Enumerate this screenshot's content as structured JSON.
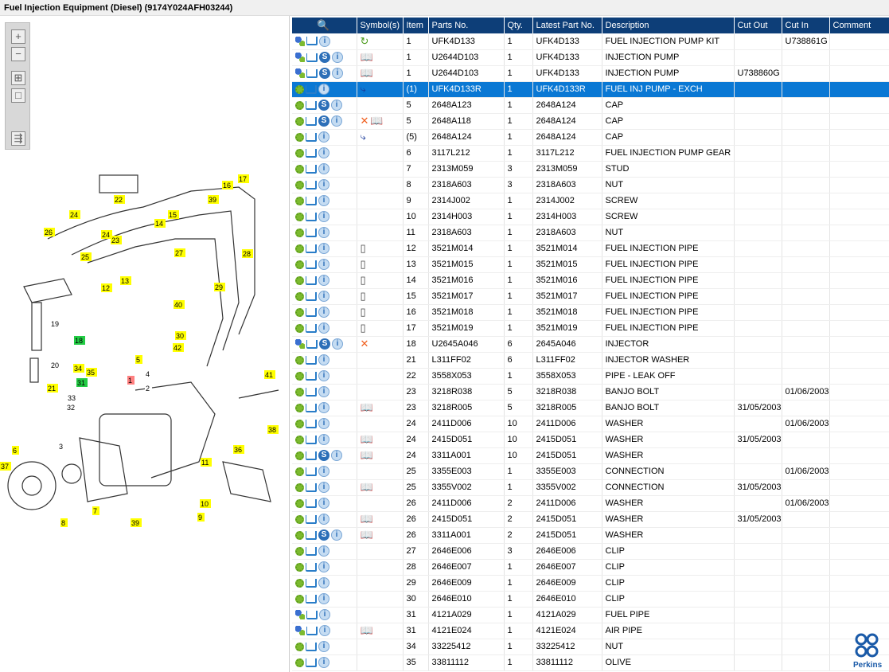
{
  "title": "Fuel Injection Equipment (Diesel) (9174Y024AFH03244)",
  "toolbar": {
    "zoom_in": "+",
    "zoom_out": "−",
    "fit": "⊞",
    "window": "□",
    "export": "⇶"
  },
  "columns": [
    "",
    "Symbol(s)",
    "Item",
    "Parts No.",
    "Qty.",
    "Latest Part No.",
    "Description",
    "Cut Out",
    "Cut In",
    "Comment"
  ],
  "selected_row": 3,
  "rows": [
    {
      "a": "b",
      "s": 0,
      "sym": "rotate",
      "item": "1",
      "part": "UFK4D133",
      "qty": "1",
      "latest": "UFK4D133",
      "desc": "FUEL INJECTION PUMP KIT",
      "out": "",
      "in": "U738861G"
    },
    {
      "a": "b",
      "s": 1,
      "sym": "book",
      "item": "1",
      "part": "U2644D103",
      "qty": "1",
      "latest": "UFK4D133",
      "desc": "INJECTION PUMP",
      "out": "",
      "in": ""
    },
    {
      "a": "b",
      "s": 1,
      "sym": "book",
      "item": "1",
      "part": "U2644D103",
      "qty": "1",
      "latest": "UFK4D133",
      "desc": "INJECTION PUMP",
      "out": "U738860G",
      "in": ""
    },
    {
      "a": "g",
      "s": 0,
      "sym": "arrow",
      "item": "(1)",
      "part": "UFK4D133R",
      "qty": "1",
      "latest": "UFK4D133R",
      "desc": "FUEL INJ PUMP - EXCH",
      "out": "",
      "in": ""
    },
    {
      "a": "g",
      "s": 1,
      "sym": "",
      "item": "5",
      "part": "2648A123",
      "qty": "1",
      "latest": "2648A124",
      "desc": "CAP",
      "out": "",
      "in": ""
    },
    {
      "a": "g",
      "s": 1,
      "sym": "xbook",
      "item": "5",
      "part": "2648A118",
      "qty": "1",
      "latest": "2648A124",
      "desc": "CAP",
      "out": "",
      "in": ""
    },
    {
      "a": "g",
      "s": 0,
      "sym": "arrow",
      "item": "(5)",
      "part": "2648A124",
      "qty": "1",
      "latest": "2648A124",
      "desc": "CAP",
      "out": "",
      "in": ""
    },
    {
      "a": "g",
      "s": 0,
      "sym": "",
      "item": "6",
      "part": "3117L212",
      "qty": "1",
      "latest": "3117L212",
      "desc": "FUEL INJECTION PUMP GEAR",
      "out": "",
      "in": ""
    },
    {
      "a": "g",
      "s": 0,
      "sym": "",
      "item": "7",
      "part": "2313M059",
      "qty": "3",
      "latest": "2313M059",
      "desc": "STUD",
      "out": "",
      "in": ""
    },
    {
      "a": "g",
      "s": 0,
      "sym": "",
      "item": "8",
      "part": "2318A603",
      "qty": "3",
      "latest": "2318A603",
      "desc": "NUT",
      "out": "",
      "in": ""
    },
    {
      "a": "g",
      "s": 0,
      "sym": "",
      "item": "9",
      "part": "2314J002",
      "qty": "1",
      "latest": "2314J002",
      "desc": "SCREW",
      "out": "",
      "in": ""
    },
    {
      "a": "g",
      "s": 0,
      "sym": "",
      "item": "10",
      "part": "2314H003",
      "qty": "1",
      "latest": "2314H003",
      "desc": "SCREW",
      "out": "",
      "in": ""
    },
    {
      "a": "g",
      "s": 0,
      "sym": "",
      "item": "11",
      "part": "2318A603",
      "qty": "1",
      "latest": "2318A603",
      "desc": "NUT",
      "out": "",
      "in": ""
    },
    {
      "a": "g",
      "s": 0,
      "sym": "can",
      "item": "12",
      "part": "3521M014",
      "qty": "1",
      "latest": "3521M014",
      "desc": "FUEL INJECTION PIPE",
      "out": "",
      "in": ""
    },
    {
      "a": "g",
      "s": 0,
      "sym": "can",
      "item": "13",
      "part": "3521M015",
      "qty": "1",
      "latest": "3521M015",
      "desc": "FUEL INJECTION PIPE",
      "out": "",
      "in": ""
    },
    {
      "a": "g",
      "s": 0,
      "sym": "can",
      "item": "14",
      "part": "3521M016",
      "qty": "1",
      "latest": "3521M016",
      "desc": "FUEL INJECTION PIPE",
      "out": "",
      "in": ""
    },
    {
      "a": "g",
      "s": 0,
      "sym": "can",
      "item": "15",
      "part": "3521M017",
      "qty": "1",
      "latest": "3521M017",
      "desc": "FUEL INJECTION PIPE",
      "out": "",
      "in": ""
    },
    {
      "a": "g",
      "s": 0,
      "sym": "can",
      "item": "16",
      "part": "3521M018",
      "qty": "1",
      "latest": "3521M018",
      "desc": "FUEL INJECTION PIPE",
      "out": "",
      "in": ""
    },
    {
      "a": "g",
      "s": 0,
      "sym": "can",
      "item": "17",
      "part": "3521M019",
      "qty": "1",
      "latest": "3521M019",
      "desc": "FUEL INJECTION PIPE",
      "out": "",
      "in": ""
    },
    {
      "a": "b",
      "s": 1,
      "sym": "x",
      "item": "18",
      "part": "U2645A046",
      "qty": "6",
      "latest": "2645A046",
      "desc": "INJECTOR",
      "out": "",
      "in": ""
    },
    {
      "a": "g",
      "s": 0,
      "sym": "",
      "item": "21",
      "part": "L311FF02",
      "qty": "6",
      "latest": "L311FF02",
      "desc": "INJECTOR WASHER",
      "out": "",
      "in": ""
    },
    {
      "a": "g",
      "s": 0,
      "sym": "",
      "item": "22",
      "part": "3558X053",
      "qty": "1",
      "latest": "3558X053",
      "desc": "PIPE - LEAK OFF",
      "out": "",
      "in": ""
    },
    {
      "a": "g",
      "s": 0,
      "sym": "",
      "item": "23",
      "part": "3218R038",
      "qty": "5",
      "latest": "3218R038",
      "desc": "BANJO BOLT",
      "out": "",
      "in": "01/06/2003"
    },
    {
      "a": "g",
      "s": 0,
      "sym": "book",
      "item": "23",
      "part": "3218R005",
      "qty": "5",
      "latest": "3218R005",
      "desc": "BANJO BOLT",
      "out": "31/05/2003",
      "in": ""
    },
    {
      "a": "g",
      "s": 0,
      "sym": "",
      "item": "24",
      "part": "2411D006",
      "qty": "10",
      "latest": "2411D006",
      "desc": "WASHER",
      "out": "",
      "in": "01/06/2003"
    },
    {
      "a": "g",
      "s": 0,
      "sym": "book",
      "item": "24",
      "part": "2415D051",
      "qty": "10",
      "latest": "2415D051",
      "desc": "WASHER",
      "out": "31/05/2003",
      "in": ""
    },
    {
      "a": "g",
      "s": 1,
      "sym": "book",
      "item": "24",
      "part": "3311A001",
      "qty": "10",
      "latest": "2415D051",
      "desc": "WASHER",
      "out": "",
      "in": ""
    },
    {
      "a": "g",
      "s": 0,
      "sym": "",
      "item": "25",
      "part": "3355E003",
      "qty": "1",
      "latest": "3355E003",
      "desc": "CONNECTION",
      "out": "",
      "in": "01/06/2003"
    },
    {
      "a": "g",
      "s": 0,
      "sym": "book",
      "item": "25",
      "part": "3355V002",
      "qty": "1",
      "latest": "3355V002",
      "desc": "CONNECTION",
      "out": "31/05/2003",
      "in": ""
    },
    {
      "a": "g",
      "s": 0,
      "sym": "",
      "item": "26",
      "part": "2411D006",
      "qty": "2",
      "latest": "2411D006",
      "desc": "WASHER",
      "out": "",
      "in": "01/06/2003"
    },
    {
      "a": "g",
      "s": 0,
      "sym": "book",
      "item": "26",
      "part": "2415D051",
      "qty": "2",
      "latest": "2415D051",
      "desc": "WASHER",
      "out": "31/05/2003",
      "in": ""
    },
    {
      "a": "g",
      "s": 1,
      "sym": "book",
      "item": "26",
      "part": "3311A001",
      "qty": "2",
      "latest": "2415D051",
      "desc": "WASHER",
      "out": "",
      "in": ""
    },
    {
      "a": "g",
      "s": 0,
      "sym": "",
      "item": "27",
      "part": "2646E006",
      "qty": "3",
      "latest": "2646E006",
      "desc": "CLIP",
      "out": "",
      "in": ""
    },
    {
      "a": "g",
      "s": 0,
      "sym": "",
      "item": "28",
      "part": "2646E007",
      "qty": "1",
      "latest": "2646E007",
      "desc": "CLIP",
      "out": "",
      "in": ""
    },
    {
      "a": "g",
      "s": 0,
      "sym": "",
      "item": "29",
      "part": "2646E009",
      "qty": "1",
      "latest": "2646E009",
      "desc": "CLIP",
      "out": "",
      "in": ""
    },
    {
      "a": "g",
      "s": 0,
      "sym": "",
      "item": "30",
      "part": "2646E010",
      "qty": "1",
      "latest": "2646E010",
      "desc": "CLIP",
      "out": "",
      "in": ""
    },
    {
      "a": "b",
      "s": 0,
      "sym": "",
      "item": "31",
      "part": "4121A029",
      "qty": "1",
      "latest": "4121A029",
      "desc": "FUEL PIPE",
      "out": "",
      "in": ""
    },
    {
      "a": "b",
      "s": 0,
      "sym": "book",
      "item": "31",
      "part": "4121E024",
      "qty": "1",
      "latest": "4121E024",
      "desc": "AIR PIPE",
      "out": "",
      "in": ""
    },
    {
      "a": "g",
      "s": 0,
      "sym": "",
      "item": "34",
      "part": "33225412",
      "qty": "1",
      "latest": "33225412",
      "desc": "NUT",
      "out": "",
      "in": ""
    },
    {
      "a": "g",
      "s": 0,
      "sym": "",
      "item": "35",
      "part": "33811112",
      "qty": "1",
      "latest": "33811112",
      "desc": "OLIVE",
      "out": "",
      "in": ""
    }
  ],
  "diagram_callouts": [
    "22",
    "24",
    "26",
    "25",
    "23",
    "24",
    "15",
    "39",
    "16",
    "17",
    "14",
    "27",
    "28",
    "12",
    "13",
    "40",
    "29",
    "30",
    "42",
    "19",
    "20",
    "18",
    "34",
    "35",
    "31",
    "21",
    "5",
    "1",
    "4",
    "2",
    "33",
    "32",
    "41",
    "38",
    "36",
    "6",
    "3",
    "37",
    "7",
    "8",
    "39",
    "11",
    "10",
    "9"
  ],
  "callout_colors": {
    "default": "#ffff00",
    "18": "#22cc44",
    "31": "#22cc44",
    "1": "#ff8080"
  },
  "logo": "Perkins"
}
